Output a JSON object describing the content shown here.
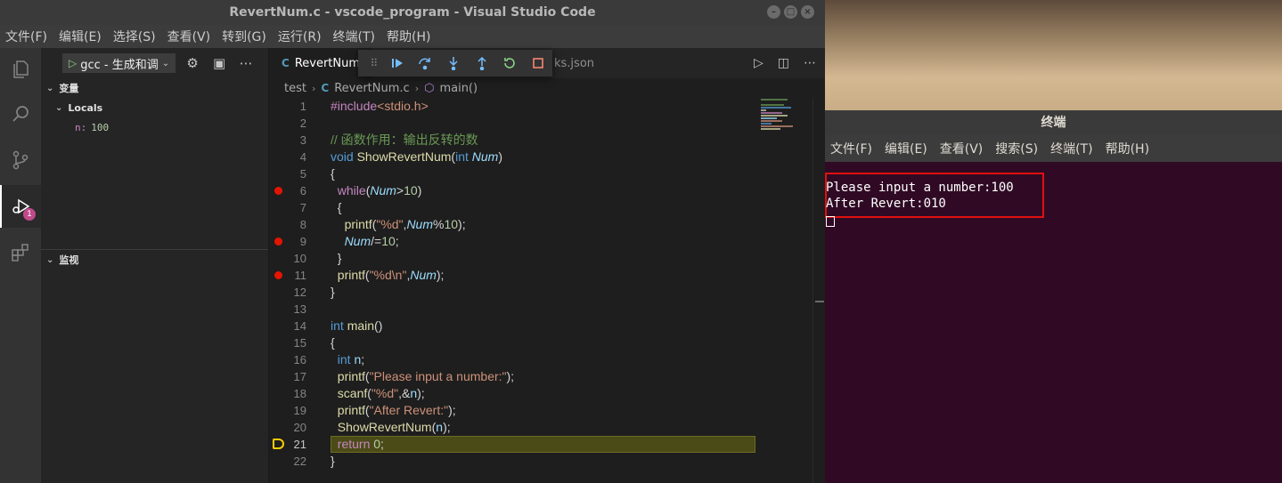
{
  "vscode": {
    "title": "RevertNum.c - vscode_program - Visual Studio Code",
    "window_buttons": [
      "–",
      "□",
      "×"
    ],
    "menu": [
      "文件(F)",
      "编辑(E)",
      "选择(S)",
      "查看(V)",
      "转到(G)",
      "运行(R)",
      "终端(T)",
      "帮助(H)"
    ],
    "activity_icons": [
      "explorer-icon",
      "search-icon",
      "source-control-icon",
      "run-debug-icon",
      "extensions-icon"
    ],
    "debug_badge": "1",
    "sidebar": {
      "config_name": "gcc - 生成和调",
      "variables_title": "变量",
      "locals_title": "Locals",
      "var_name": "n:",
      "var_value": "100",
      "watch_title": "监视"
    },
    "tabs": {
      "active": "RevertNum",
      "inactive": "ks.json"
    },
    "breadcrumb": {
      "folder": "test",
      "file": "RevertNum.c",
      "symbol": "main()"
    },
    "current_line": 21
  },
  "terminal": {
    "title": "终端",
    "menu": [
      "文件(F)",
      "编辑(E)",
      "查看(V)",
      "搜索(S)",
      "终端(T)",
      "帮助(H)"
    ],
    "output": [
      "Please input a number:100",
      "After Revert:010"
    ]
  },
  "colors": {
    "breakpoint": "#e51400",
    "current_line_arrow": "#ffcc00",
    "terminal_bg": "#300a24",
    "highlight_box": "#e01010"
  }
}
